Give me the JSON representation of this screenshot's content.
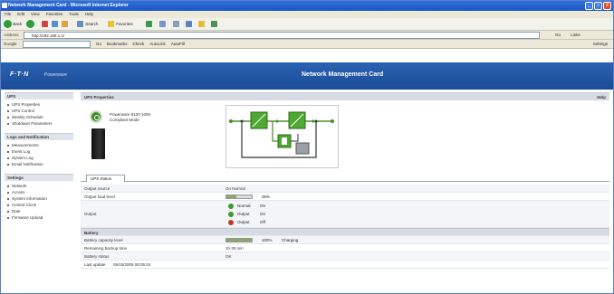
{
  "window": {
    "title": "Network Management Card - Microsoft Internet Explorer",
    "minimize": "_",
    "maximize": "□",
    "close": "X"
  },
  "menu": [
    "File",
    "Edit",
    "View",
    "Favorites",
    "Tools",
    "Help"
  ],
  "toolbar": {
    "back": "Back",
    "search": "Search",
    "favorites": "Favorites"
  },
  "address": {
    "label": "Address",
    "url": "http://192.168.1.1/",
    "go": "Go",
    "links": "Links"
  },
  "googlebar": {
    "label": "Google",
    "items": [
      "Go",
      "Bookmarks",
      "Check",
      "AutoLink",
      "AutoFill"
    ],
    "settings": "Settings"
  },
  "header": {
    "logo": "F·T·N",
    "tagline": "Powerware",
    "title": "Network Management Card"
  },
  "sidebar": {
    "groups": [
      {
        "title": "UPS",
        "items": [
          "UPS Properties",
          "UPS Control",
          "Weekly Schedule",
          "Shutdown Parameters"
        ]
      },
      {
        "title": "Logs and Notification",
        "items": [
          "Measurements",
          "Event Log",
          "System Log",
          "Email Notification"
        ]
      },
      {
        "title": "Settings",
        "items": [
          "Network",
          "Access",
          "System Information",
          "Central Clock",
          "Date",
          "Firmware Upload"
        ]
      }
    ]
  },
  "main": {
    "section_title": "UPS Properties",
    "help": "Help",
    "status_line1": "Powerware 9120 1000",
    "status_line2": "Compliant Mode",
    "tab_label": "UPS Status",
    "rows": {
      "output_source": {
        "label": "Output source",
        "value": "On Normal"
      },
      "output_load": {
        "label": "Output load level",
        "percent": 38,
        "value_text": "38%"
      },
      "output_label": "Output",
      "leds": [
        {
          "label": "Normal",
          "value": "On",
          "color": "#3e9a2a"
        },
        {
          "label": "Output",
          "value": "On",
          "color": "#3e9a2a"
        },
        {
          "label": "Output",
          "value": "Off",
          "color": "#c0392b"
        }
      ],
      "battery_head": "Battery",
      "battery_capacity": {
        "label": "Battery capacity level",
        "percent": 100,
        "value_text": "100%",
        "extra": "Charging"
      },
      "battery_runtime": {
        "label": "Remaining backup time",
        "value": "1h 35 min"
      },
      "battery_status": {
        "label": "Battery status",
        "value": "OK"
      },
      "last_update": {
        "label": "Last update",
        "value": "05/15/2009 08:05:24"
      }
    }
  },
  "colors": {
    "accent": "#1b4c96",
    "ok": "#3e9a2a",
    "fault": "#c0392b"
  }
}
